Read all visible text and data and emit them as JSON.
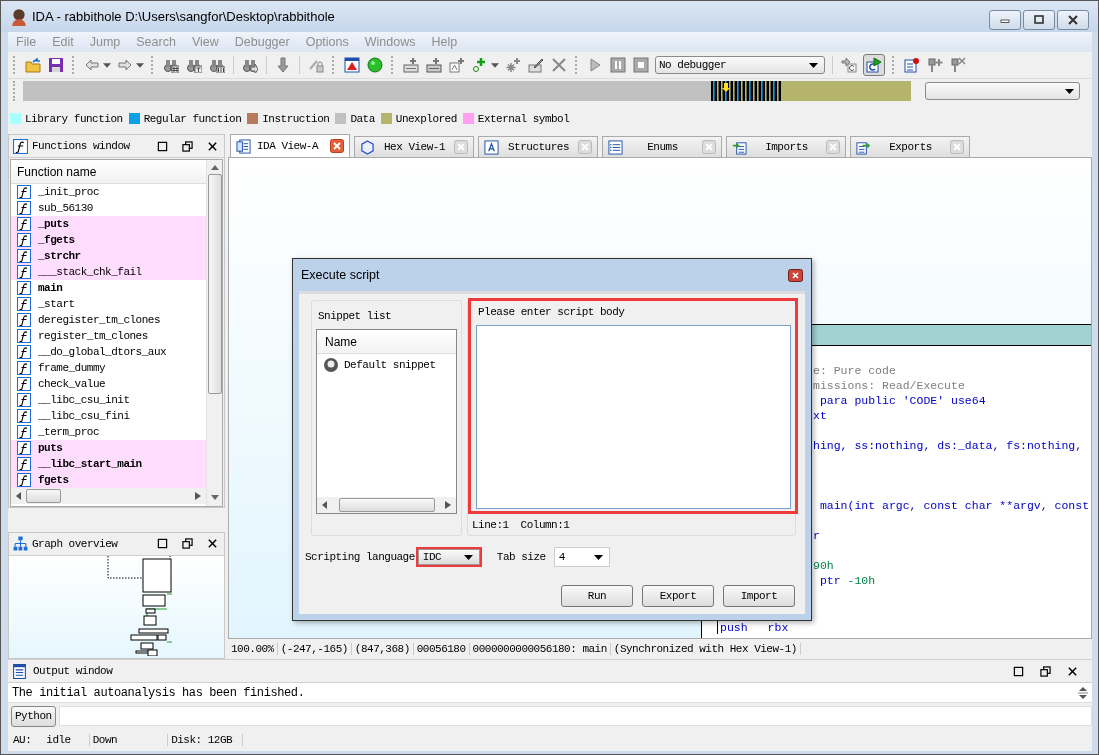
{
  "window": {
    "title": "IDA - rabbithole D:\\Users\\sangfor\\Desktop\\rabbithole"
  },
  "menu": [
    {
      "label": "File",
      "disabled": true
    },
    {
      "label": "Edit",
      "disabled": true
    },
    {
      "label": "Jump",
      "disabled": true
    },
    {
      "label": "Search",
      "disabled": true
    },
    {
      "label": "View",
      "disabled": true
    },
    {
      "label": "Debugger",
      "disabled": true
    },
    {
      "label": "Options",
      "disabled": true
    },
    {
      "label": "Windows",
      "disabled": true
    },
    {
      "label": "Help",
      "disabled": true
    }
  ],
  "toolbar": {
    "debugger": "No debugger"
  },
  "legend": [
    {
      "label": "Library function",
      "color": "#a8ffff"
    },
    {
      "label": "Regular function",
      "color": "#0aa0e6"
    },
    {
      "label": "Instruction",
      "color": "#b87a5a"
    },
    {
      "label": "Data",
      "color": "#c0c0c0"
    },
    {
      "label": "Unexplored",
      "color": "#b4b46c"
    },
    {
      "label": "External symbol",
      "color": "#ffa0f0"
    }
  ],
  "functions_window": {
    "title": "Functions window",
    "column": "Function name",
    "rows": [
      {
        "name": "_init_proc",
        "external": false,
        "bold": false
      },
      {
        "name": "sub_56130",
        "external": false,
        "bold": false
      },
      {
        "name": "_puts",
        "external": true,
        "bold": true
      },
      {
        "name": "_fgets",
        "external": true,
        "bold": true
      },
      {
        "name": "_strchr",
        "external": true,
        "bold": true
      },
      {
        "name": "___stack_chk_fail",
        "external": true,
        "bold": false
      },
      {
        "name": "main",
        "external": false,
        "bold": true
      },
      {
        "name": "_start",
        "external": false,
        "bold": false
      },
      {
        "name": "deregister_tm_clones",
        "external": false,
        "bold": false
      },
      {
        "name": "register_tm_clones",
        "external": false,
        "bold": false
      },
      {
        "name": "__do_global_dtors_aux",
        "external": false,
        "bold": false
      },
      {
        "name": "frame_dummy",
        "external": false,
        "bold": false
      },
      {
        "name": "check_value",
        "external": false,
        "bold": false
      },
      {
        "name": "__libc_csu_init",
        "external": false,
        "bold": false
      },
      {
        "name": "__libc_csu_fini",
        "external": false,
        "bold": false
      },
      {
        "name": "_term_proc",
        "external": false,
        "bold": false
      },
      {
        "name": "puts",
        "external": true,
        "bold": true
      },
      {
        "name": "__libc_start_main",
        "external": true,
        "bold": true
      },
      {
        "name": "fgets",
        "external": true,
        "bold": true
      }
    ]
  },
  "graph_overview": {
    "title": "Graph overview"
  },
  "tabs": [
    {
      "label": "IDA View-A",
      "selected": true
    },
    {
      "label": "Hex View-1",
      "selected": false
    },
    {
      "label": "Structures",
      "selected": false
    },
    {
      "label": "Enums",
      "selected": false
    },
    {
      "label": "Imports",
      "selected": false
    },
    {
      "label": "Exports",
      "selected": false
    }
  ],
  "graph_view": {
    "lines": [
      {
        "kind": "text",
        "parts": [
          {
            "text": "e: Pure code",
            "kind": "comment"
          }
        ]
      },
      {
        "kind": "text",
        "parts": [
          {
            "text": "missions: Read/Execute",
            "kind": "comment"
          }
        ]
      },
      {
        "kind": "text",
        "parts": [
          {
            "text": " para public 'CODE' use64",
            "kind": "code"
          }
        ]
      },
      {
        "kind": "text",
        "parts": [
          {
            "text": "xt",
            "kind": "code"
          }
        ]
      },
      {
        "kind": "blank"
      },
      {
        "kind": "text",
        "parts": [
          {
            "text": "hing, ss:nothing, ds:_data, fs:nothing,",
            "kind": "code"
          }
        ]
      },
      {
        "kind": "blank"
      },
      {
        "kind": "blank"
      },
      {
        "kind": "blank"
      },
      {
        "kind": "text",
        "parts": [
          {
            "text": " main(int argc, const char **argv, const",
            "kind": "code"
          }
        ]
      },
      {
        "kind": "blank"
      },
      {
        "kind": "text",
        "parts": [
          {
            "text": "r",
            "kind": "code"
          }
        ]
      },
      {
        "kind": "blank"
      },
      {
        "kind": "text",
        "parts": [
          {
            "text": "90h",
            "kind": "number"
          }
        ]
      },
      {
        "kind": "text",
        "parts": [
          {
            "text": " ptr ",
            "kind": "code"
          },
          {
            "text": "-10h",
            "kind": "number"
          }
        ]
      }
    ],
    "instruction": {
      "mnemonic": "push",
      "operand": "rbx"
    },
    "status": [
      "100.00%",
      "(-247,-165)",
      "(847,368)",
      "00056180",
      "0000000000056180: main",
      "(Synchronized with Hex View-1)"
    ]
  },
  "dialog": {
    "title": "Execute script",
    "snippet_list": {
      "label": "Snippet list",
      "column": "Name",
      "items": [
        {
          "label": "Default snippet",
          "selected": false
        }
      ]
    },
    "script_body": {
      "label": "Please enter script body",
      "line": "Line:1",
      "column": "Column:1",
      "highlighted": true
    },
    "scripting_language": {
      "label": "Scripting language",
      "value": "IDC",
      "highlighted": true
    },
    "tab_size": {
      "label": "Tab size",
      "value": "4"
    },
    "buttons": [
      "Run",
      "Export",
      "Import"
    ]
  },
  "output_window": {
    "title": "Output window",
    "message": "The initial autoanalysis has been finished.",
    "language": "Python"
  },
  "status_bar": [
    "AU:",
    "idle",
    "Down",
    "Disk: 12GB"
  ]
}
